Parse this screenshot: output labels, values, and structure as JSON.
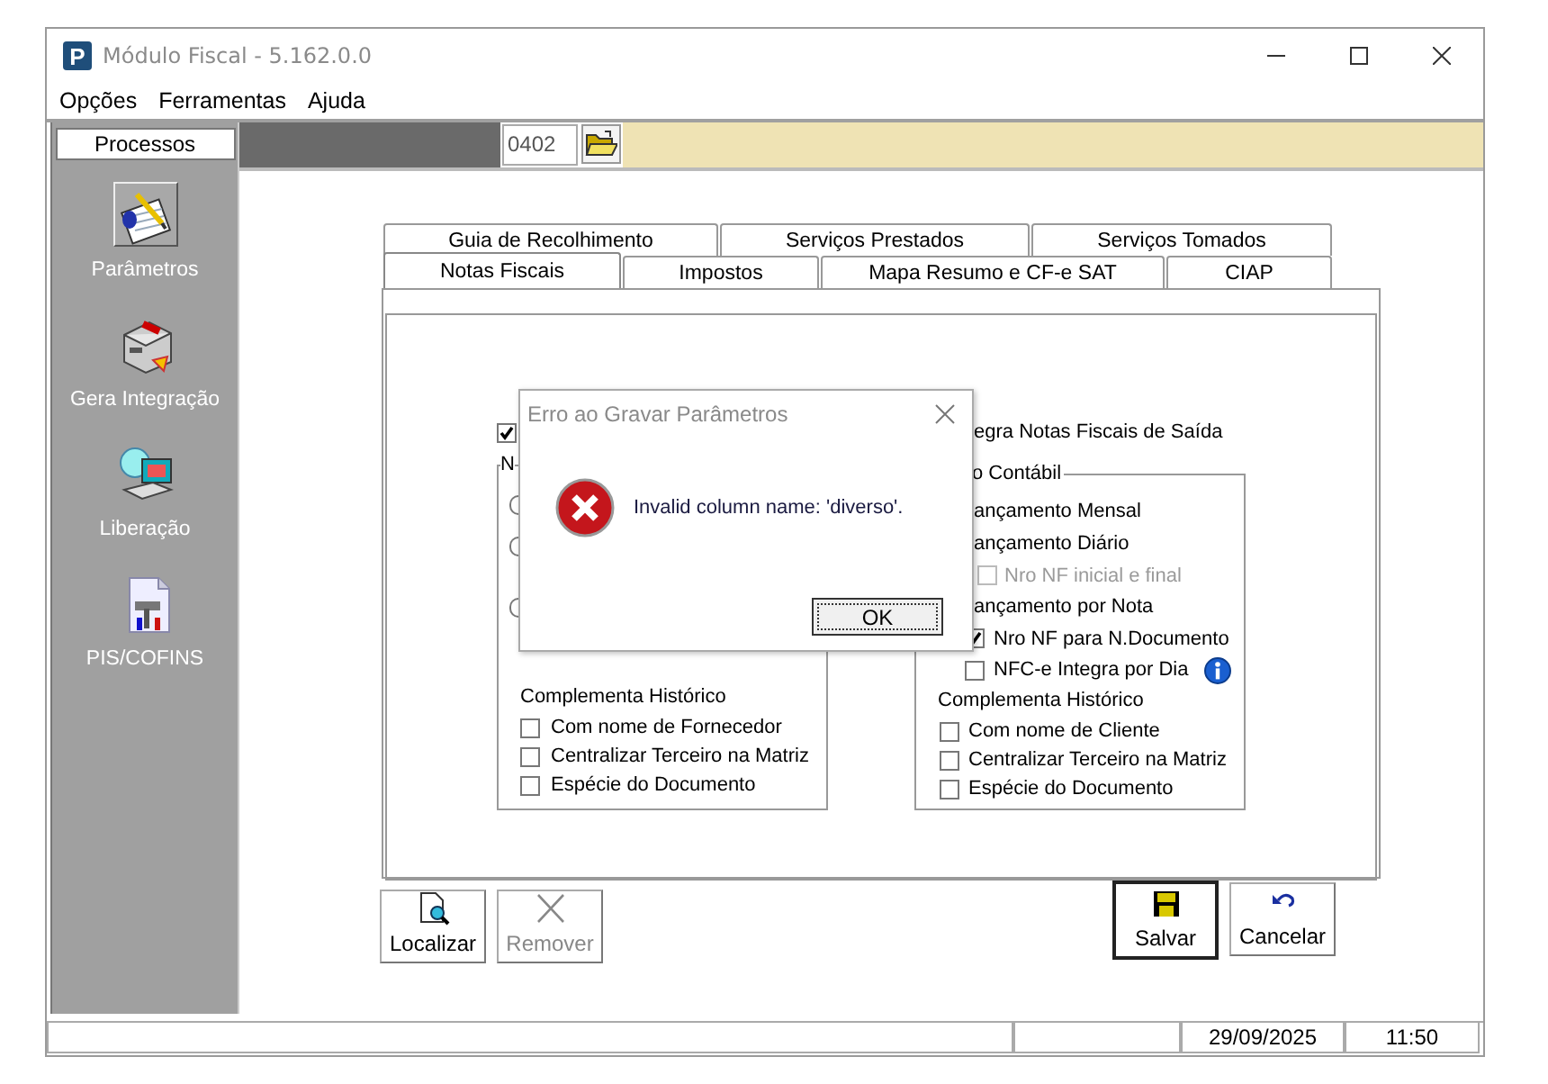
{
  "window": {
    "app_icon_text": "P",
    "title": "Módulo Fiscal - 5.162.0.0"
  },
  "menu": [
    {
      "label": "Opções"
    },
    {
      "label": "Ferramentas"
    },
    {
      "label": "Ajuda"
    }
  ],
  "sidebar": {
    "header": "Processos",
    "items": [
      {
        "label": "Parâmetros",
        "selected": true
      },
      {
        "label": "Gera Integração",
        "selected": false
      },
      {
        "label": "Liberação",
        "selected": false
      },
      {
        "label": "PIS/COFINS",
        "selected": false
      }
    ]
  },
  "toolbar": {
    "code": "0402"
  },
  "tab_rows": [
    [
      {
        "label": "Guia de Recolhimento",
        "selected": false
      },
      {
        "label": "Serviços Prestados",
        "selected": false
      },
      {
        "label": "Serviços Tomados",
        "selected": false
      }
    ],
    [
      {
        "label": "Notas Fiscais",
        "selected": true
      },
      {
        "label": "Impostos",
        "selected": false
      },
      {
        "label": "Mapa Resumo e CF-e SAT",
        "selected": false
      },
      {
        "label": "CIAP",
        "selected": false
      }
    ]
  ],
  "panel": {
    "top_checkbox": {
      "checked": true
    },
    "right_top_label": "egra Notas Fiscais de Saída",
    "left_group": {
      "caption": "N",
      "radios": [
        {
          "selected": false
        },
        {
          "selected": false
        },
        {
          "selected": false
        }
      ],
      "history_heading": "Complementa Histórico",
      "history_options": [
        {
          "label": "Com nome de Fornecedor",
          "checked": false
        },
        {
          "label": "Centralizar Terceiro na Matriz",
          "checked": false
        },
        {
          "label": "Espécie do Documento",
          "checked": false
        }
      ]
    },
    "right_group": {
      "caption": "o Contábil",
      "rows": [
        {
          "kind": "option",
          "label": "ançamento Mensal"
        },
        {
          "kind": "option",
          "label": "ançamento Diário"
        },
        {
          "kind": "suboption",
          "label": "Nro NF inicial e final",
          "checked": false,
          "disabled": true
        },
        {
          "kind": "option",
          "label": "ançamento por Nota"
        },
        {
          "kind": "suboption",
          "label": "Nro NF para N.Documento",
          "checked": true,
          "disabled": false
        },
        {
          "kind": "info",
          "label": "NFC-e Integra por Dia",
          "checked": false,
          "disabled": false
        }
      ],
      "history_heading": "Complementa Histórico",
      "history_options": [
        {
          "label": "Com nome de Cliente",
          "checked": false
        },
        {
          "label": "Centralizar Terceiro na Matriz",
          "checked": false
        },
        {
          "label": "Espécie do Documento",
          "checked": false
        }
      ]
    }
  },
  "dialog": {
    "title": "Erro ao Gravar Parâmetros",
    "message": "Invalid column name: 'diverso'.",
    "button": "OK"
  },
  "left_buttons": [
    {
      "label": "Localizar",
      "disabled": false
    },
    {
      "label": "Remover",
      "disabled": true
    }
  ],
  "right_buttons": [
    {
      "label": "Salvar",
      "default": true
    },
    {
      "label": "Cancelar",
      "default": false
    }
  ],
  "status_bar": {
    "date": "29/09/2025",
    "time": "11:50"
  }
}
